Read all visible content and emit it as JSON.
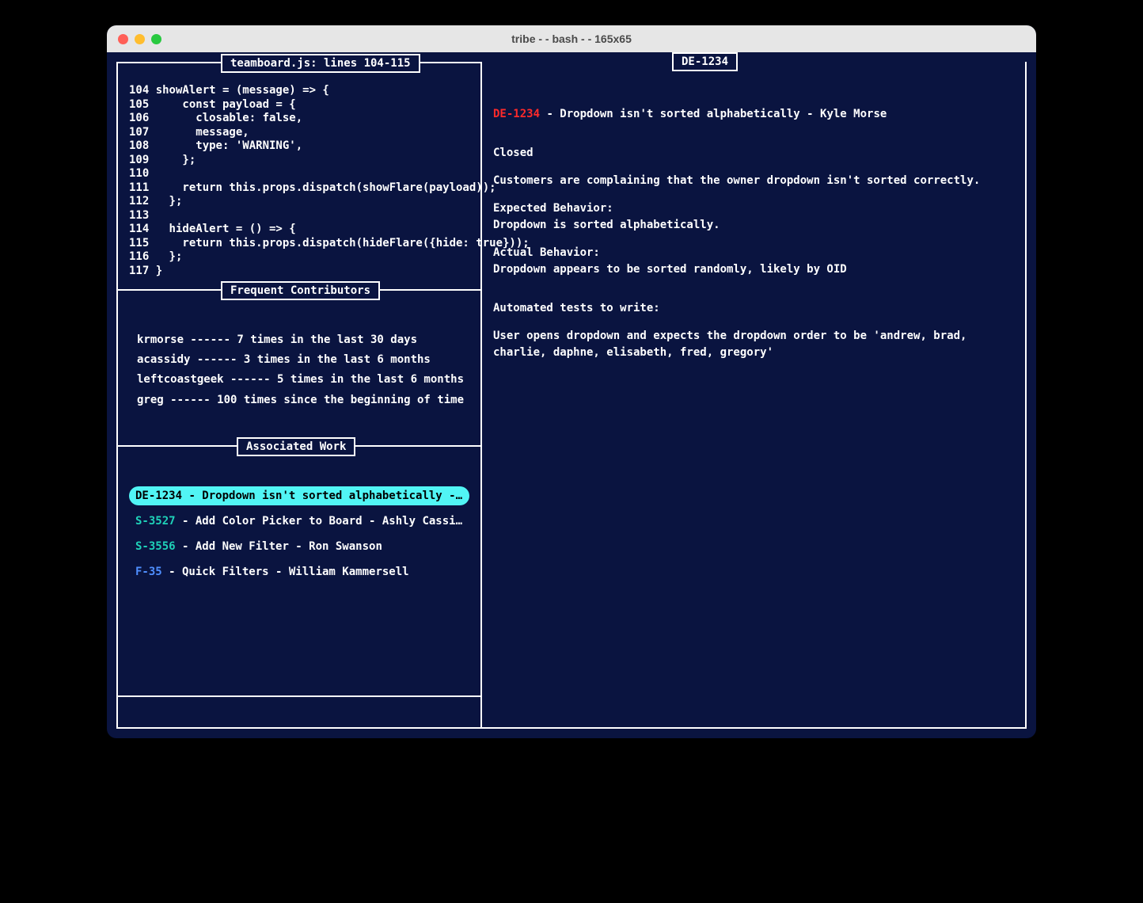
{
  "window": {
    "title": "tribe - - bash - - 165x65"
  },
  "code_panel": {
    "legend": "teamboard.js: lines 104-115",
    "lines": [
      {
        "n": "104",
        "t": "showAlert = (message) => {"
      },
      {
        "n": "105",
        "t": "    const payload = {"
      },
      {
        "n": "106",
        "t": "      closable: false,"
      },
      {
        "n": "107",
        "t": "      message,"
      },
      {
        "n": "108",
        "t": "      type: 'WARNING',"
      },
      {
        "n": "109",
        "t": "    };"
      },
      {
        "n": "110",
        "t": ""
      },
      {
        "n": "111",
        "t": "    return this.props.dispatch(showFlare(payload));"
      },
      {
        "n": "112",
        "t": "  };"
      },
      {
        "n": "113",
        "t": ""
      },
      {
        "n": "114",
        "t": "  hideAlert = () => {"
      },
      {
        "n": "115",
        "t": "    return this.props.dispatch(hideFlare({hide: true}));"
      },
      {
        "n": "116",
        "t": "  };"
      },
      {
        "n": "117",
        "t": "}"
      }
    ]
  },
  "contributors_panel": {
    "legend": "Frequent Contributors",
    "items": [
      "krmorse ------ 7 times in the last 30 days",
      "acassidy ------ 3 times in the last 6 months",
      "leftcoastgeek ------ 5 times in the last 6 months",
      "greg ------ 100 times since the beginning of time"
    ]
  },
  "work_panel": {
    "legend": "Associated Work",
    "items": [
      {
        "id": "DE-1234",
        "rest": " - Dropdown isn't sorted alphabetically - Kyle…",
        "color": "red",
        "selected": true
      },
      {
        "id": "S-3527",
        "rest": " - Add Color Picker to Board - Ashly Cassidy",
        "color": "teal",
        "selected": false
      },
      {
        "id": "S-3556",
        "rest": " - Add New Filter - Ron Swanson",
        "color": "teal",
        "selected": false
      },
      {
        "id": "F-35",
        "rest": " - Quick Filters - William Kammersell",
        "color": "blue",
        "selected": false
      }
    ]
  },
  "detail_panel": {
    "legend": "DE-1234",
    "title_id": "DE-1234",
    "title_rest": " - Dropdown isn't sorted alphabetically - Kyle Morse",
    "status": "Closed",
    "description": "Customers are complaining that the owner dropdown isn't sorted correctly.",
    "expected_label": "Expected Behavior:",
    "expected_text": "Dropdown is sorted alphabetically.",
    "actual_label": "Actual Behavior:",
    "actual_text": "Dropdown appears to be sorted randomly, likely by OID",
    "tests_label": "Automated tests to write:",
    "tests_text": "User opens dropdown and expects the dropdown order to be 'andrew, brad, charlie, daphne, elisabeth, fred, gregory'"
  }
}
